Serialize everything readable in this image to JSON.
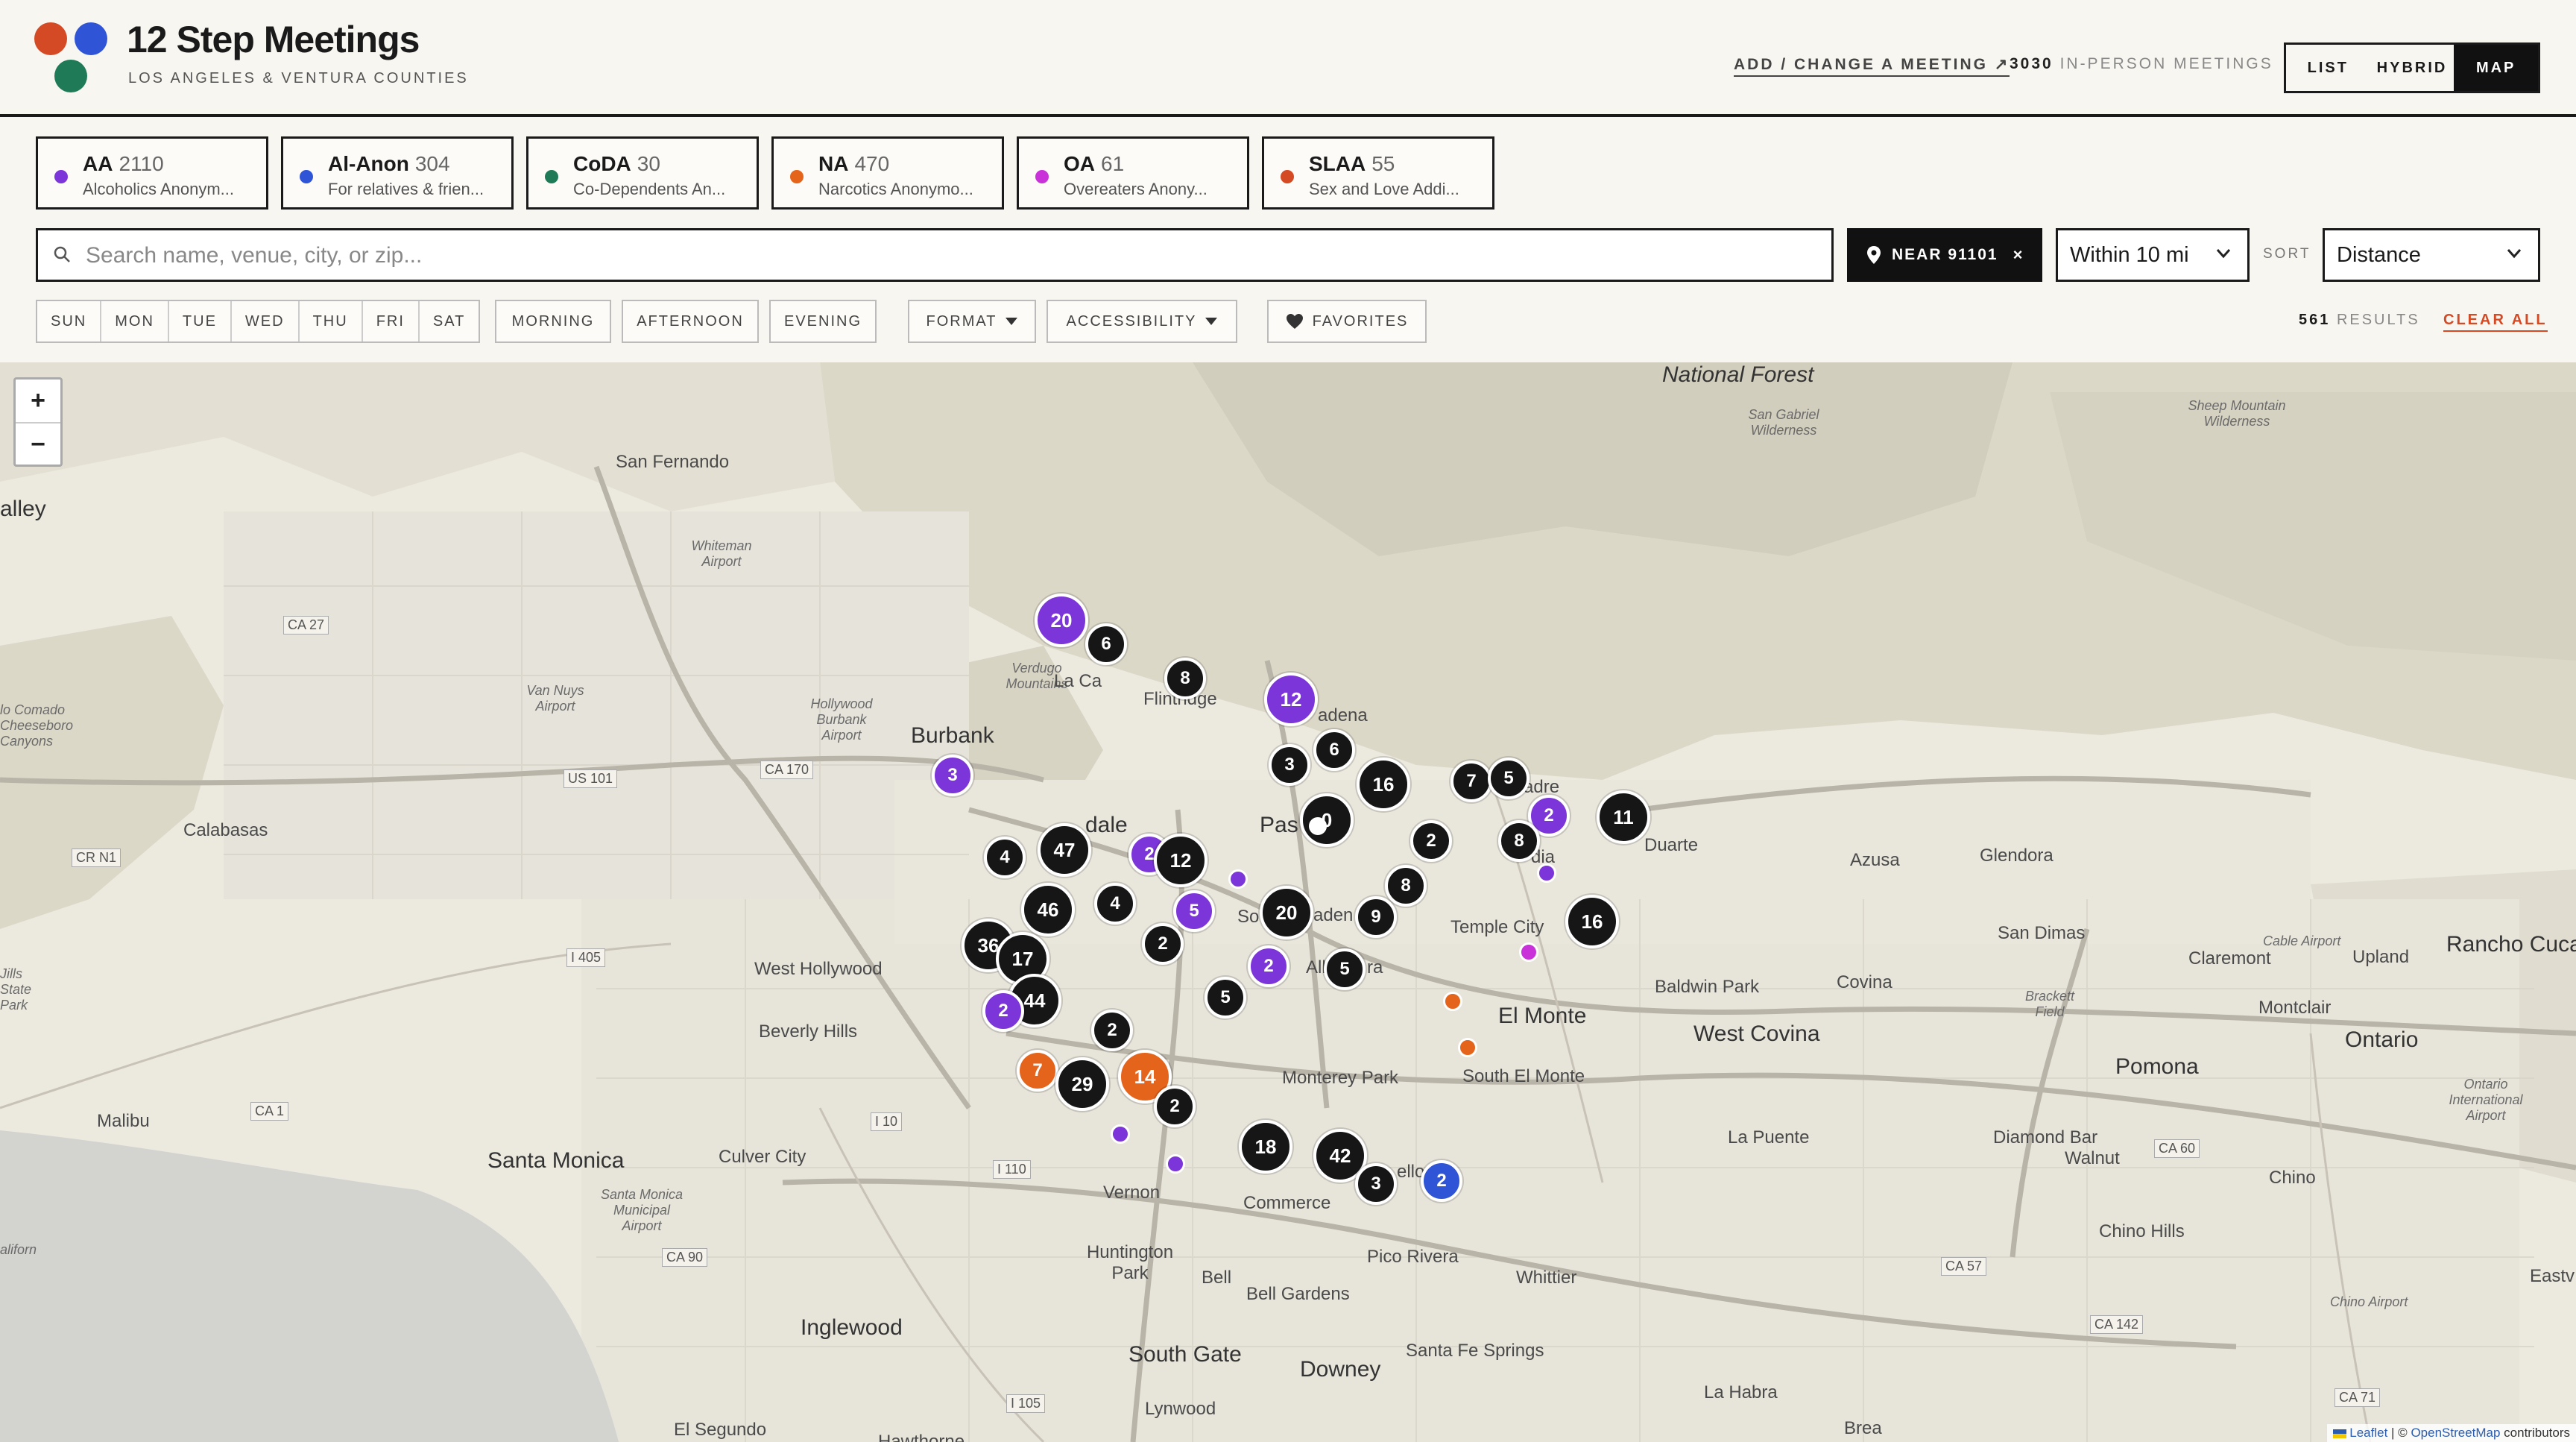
{
  "colors": {
    "aa": "#7c35d9",
    "alanon": "#2f54d6",
    "coda": "#1f7a57",
    "na": "#e5641c",
    "oa": "#c832d8",
    "slaa": "#d44a25",
    "accent": "#d44a25"
  },
  "header": {
    "title": "12 Step Meetings",
    "subtitle": "LOS ANGELES & VENTURA COUNTIES",
    "add_link": "ADD / CHANGE A MEETING ↗",
    "count_number": "3030",
    "count_label": "IN-PERSON MEETINGS",
    "views": [
      "LIST",
      "HYBRID",
      "MAP"
    ],
    "active_view": "MAP"
  },
  "fellowships": [
    {
      "name": "AA",
      "count": "2110",
      "desc": "Alcoholics Anonym...",
      "color": "#7c35d9"
    },
    {
      "name": "Al-Anon",
      "count": "304",
      "desc": "For relatives & frien...",
      "color": "#2f54d6"
    },
    {
      "name": "CoDA",
      "count": "30",
      "desc": "Co-Dependents An...",
      "color": "#1f7a57"
    },
    {
      "name": "NA",
      "count": "470",
      "desc": "Narcotics Anonymo...",
      "color": "#e5641c"
    },
    {
      "name": "OA",
      "count": "61",
      "desc": "Overeaters Anony...",
      "color": "#c832d8"
    },
    {
      "name": "SLAA",
      "count": "55",
      "desc": "Sex and Love Addi...",
      "color": "#d44a25"
    }
  ],
  "search": {
    "placeholder": "Search name, venue, city, or zip...",
    "value": ""
  },
  "near": {
    "label": "NEAR 91101",
    "clear": "×"
  },
  "distance": {
    "selected": "Within 10 mi"
  },
  "sort": {
    "label": "SORT",
    "selected": "Distance"
  },
  "filters": {
    "days": [
      "SUN",
      "MON",
      "TUE",
      "WED",
      "THU",
      "FRI",
      "SAT"
    ],
    "times": [
      "MORNING",
      "AFTERNOON",
      "EVENING"
    ],
    "format": "FORMAT",
    "accessibility": "ACCESSIBILITY",
    "favorites": "FAVORITES"
  },
  "results": {
    "count": "561",
    "label": "RESULTS",
    "clear": "CLEAR ALL"
  },
  "map": {
    "zoom_in": "+",
    "zoom_out": "−",
    "attribution": {
      "leaflet": "Leaflet",
      "sep": " | © ",
      "osm": "OpenStreetMap",
      "suffix": " contributors"
    },
    "places": [
      {
        "t": "San Fernando"
      },
      {
        "t": "Burbank"
      },
      {
        "t": "Calabasas"
      },
      {
        "t": "West Hollywood"
      },
      {
        "t": "Beverly Hills"
      },
      {
        "t": "Santa Monica"
      },
      {
        "t": "Culver City"
      },
      {
        "t": "Malibu"
      },
      {
        "t": "Inglewood"
      },
      {
        "t": "South Gate"
      },
      {
        "t": "Downey"
      },
      {
        "t": "Vernon"
      },
      {
        "t": "Commerce"
      },
      {
        "t": "Huntington Park"
      },
      {
        "t": "Bell"
      },
      {
        "t": "Bell Gardens"
      },
      {
        "t": "Pico Rivera"
      },
      {
        "t": "Monterey Park"
      },
      {
        "t": "South El Monte"
      },
      {
        "t": "El Monte"
      },
      {
        "t": "Temple City"
      },
      {
        "t": "Baldwin Park"
      },
      {
        "t": "West Covina"
      },
      {
        "t": "Covina"
      },
      {
        "t": "Azusa"
      },
      {
        "t": "Glendora"
      },
      {
        "t": "Duarte"
      },
      {
        "t": "San Dimas"
      },
      {
        "t": "Claremont"
      },
      {
        "t": "Upland"
      },
      {
        "t": "Rancho Cucar"
      },
      {
        "t": "Montclair"
      },
      {
        "t": "Ontario"
      },
      {
        "t": "Pomona"
      },
      {
        "t": "Diamond Bar"
      },
      {
        "t": "Walnut"
      },
      {
        "t": "La Puente"
      },
      {
        "t": "Chino"
      },
      {
        "t": "Chino Hills"
      },
      {
        "t": "Whittier"
      },
      {
        "t": "Santa Fe Springs"
      },
      {
        "t": "La Habra"
      },
      {
        "t": "Lynwood"
      },
      {
        "t": "El Segundo"
      },
      {
        "t": "Flintridge"
      },
      {
        "t": "National Forest"
      },
      {
        "t": "Eastv"
      },
      {
        "t": "Brea"
      },
      {
        "t": "Hawthorne"
      },
      {
        "t": "Verdugo Mountains"
      },
      {
        "t": "San Gabriel Wilderness"
      },
      {
        "t": "Sheep Mountain Wilderness"
      },
      {
        "t": "Whiteman Airport"
      },
      {
        "t": "Van Nuys Airport"
      },
      {
        "t": "Hollywood Burbank Airport"
      },
      {
        "t": "Santa Monica Municipal Airport"
      },
      {
        "t": "Cable Airport"
      },
      {
        "t": "Brackett Field"
      },
      {
        "t": "Ontario International Airport"
      },
      {
        "t": "Chino Airport"
      },
      {
        "t": "alley"
      },
      {
        "t": "lo Comado Cheeseboro Canyons"
      },
      {
        "t": "Jills State Park"
      },
      {
        "t": "aliforn"
      },
      {
        "t": "La Ca"
      },
      {
        "t": "Pas"
      },
      {
        "t": "adena"
      },
      {
        "t": "adre"
      },
      {
        "t": "dia"
      },
      {
        "t": "dale"
      },
      {
        "t": "Alh"
      },
      {
        "t": "ra"
      },
      {
        "t": "So"
      },
      {
        "t": "aden"
      },
      {
        "t": "ello"
      }
    ],
    "highways": [
      "CA 27",
      "US 101",
      "CA 170",
      "CR N1",
      "I 405",
      "CA 1",
      "I 10",
      "I 110",
      "CA 90",
      "I 105",
      "CA 57",
      "CA 60",
      "CA 142",
      "CA 71"
    ],
    "clusters": [
      {
        "n": "20",
        "c": "purple"
      },
      {
        "n": "6",
        "c": "dark"
      },
      {
        "n": "8",
        "c": "dark"
      },
      {
        "n": "12",
        "c": "purple"
      },
      {
        "n": "3",
        "c": "purple"
      },
      {
        "n": "3",
        "c": "dark"
      },
      {
        "n": "6",
        "c": "dark"
      },
      {
        "n": "16",
        "c": "dark"
      },
      {
        "n": "7",
        "c": "dark"
      },
      {
        "n": "5",
        "c": "dark"
      },
      {
        "n": "2",
        "c": "purple"
      },
      {
        "n": "11",
        "c": "dark"
      },
      {
        "n": "0",
        "c": "dark"
      },
      {
        "n": "2",
        "c": "dark"
      },
      {
        "n": "8",
        "c": "dark"
      },
      {
        "n": "4",
        "c": "dark"
      },
      {
        "n": "47",
        "c": "dark"
      },
      {
        "n": "2",
        "c": "purple"
      },
      {
        "n": "12",
        "c": "dark"
      },
      {
        "n": "46",
        "c": "dark"
      },
      {
        "n": "4",
        "c": "dark"
      },
      {
        "n": "5",
        "c": "purple"
      },
      {
        "n": "20",
        "c": "dark"
      },
      {
        "n": "8",
        "c": "dark"
      },
      {
        "n": "9",
        "c": "dark"
      },
      {
        "n": "16",
        "c": "dark"
      },
      {
        "n": "36",
        "c": "dark"
      },
      {
        "n": "17",
        "c": "dark"
      },
      {
        "n": "2",
        "c": "dark"
      },
      {
        "n": "2",
        "c": "purple"
      },
      {
        "n": "5",
        "c": "dark"
      },
      {
        "n": "44",
        "c": "dark"
      },
      {
        "n": "2",
        "c": "purple"
      },
      {
        "n": "5",
        "c": "dark"
      },
      {
        "n": "2",
        "c": "dark"
      },
      {
        "n": "7",
        "c": "orange"
      },
      {
        "n": "29",
        "c": "dark"
      },
      {
        "n": "14",
        "c": "orange"
      },
      {
        "n": "2",
        "c": "dark"
      },
      {
        "n": "18",
        "c": "dark"
      },
      {
        "n": "42",
        "c": "dark"
      },
      {
        "n": "3",
        "c": "dark"
      },
      {
        "n": "2",
        "c": "blue"
      }
    ],
    "pins": [
      "#7c35d9",
      "#7c35d9",
      "#c832d8",
      "#e5641c",
      "#e5641c",
      "#7c35d9",
      "#7c35d9",
      "#ffffff"
    ]
  }
}
